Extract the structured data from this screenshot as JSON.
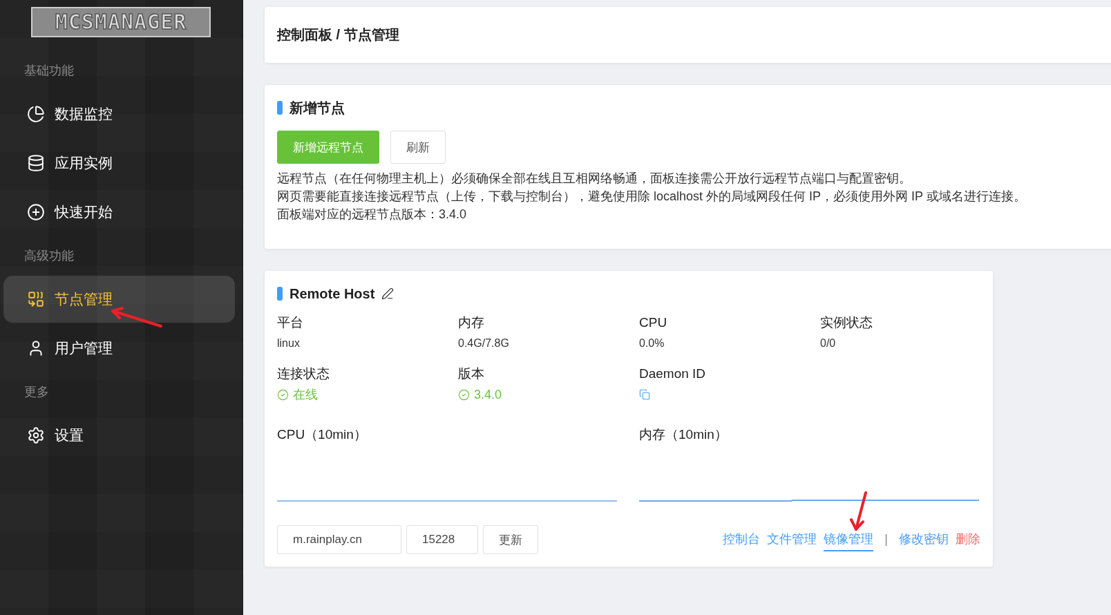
{
  "sidebar": {
    "logo": "MCSMANAGER",
    "groups": [
      {
        "title": "基础功能",
        "items": [
          {
            "label": "数据监控",
            "kind": "pie",
            "selected": false
          },
          {
            "label": "应用实例",
            "kind": "database",
            "selected": false
          },
          {
            "label": "快速开始",
            "kind": "plus",
            "selected": false
          }
        ]
      },
      {
        "title": "高级功能",
        "items": [
          {
            "label": "节点管理",
            "kind": "nodes",
            "selected": true
          },
          {
            "label": "用户管理",
            "kind": "user",
            "selected": false
          }
        ]
      },
      {
        "title": "更多",
        "items": [
          {
            "label": "设置",
            "kind": "gear",
            "selected": false
          }
        ]
      }
    ]
  },
  "breadcrumb": "控制面板 / 节点管理",
  "add_node_card": {
    "title": "新增节点",
    "buttons": [
      {
        "label": "新增远程节点",
        "kind": "primary"
      },
      {
        "label": "刷新",
        "kind": "default"
      }
    ],
    "notes": [
      "远程节点（在任何物理主机上）必须确保全部在线且互相网络畅通，面板连接需公开放行远程节点端口与配置密钥。",
      "网页需要能直接连接远程节点（上传，下载与控制台），避免使用除 localhost 外的局域网段任何 IP，必须使用外网 IP 或域名进行连接。",
      "面板端对应的远程节点版本：3.4.0"
    ]
  },
  "node_card": {
    "title": "Remote Host",
    "stats": [
      {
        "label": "平台",
        "value": "linux",
        "kind": "plain"
      },
      {
        "label": "内存",
        "value": "0.4G/7.8G",
        "kind": "plain"
      },
      {
        "label": "CPU",
        "value": "0.0%",
        "kind": "plain"
      },
      {
        "label": "实例状态",
        "value": "0/0",
        "kind": "plain"
      },
      {
        "label": "连接状态",
        "value": "在线",
        "kind": "ok"
      },
      {
        "label": "版本",
        "value": "3.4.0",
        "kind": "ok"
      },
      {
        "label": "Daemon ID",
        "kind": "copy"
      }
    ],
    "charts": [
      {
        "title": "CPU（10min）",
        "kind": "flat"
      },
      {
        "title": "内存（10min）",
        "kind": "step"
      }
    ],
    "address": "m.rainplay.cn",
    "port": "15228",
    "update_button": "更新",
    "actions": [
      {
        "label": "控制台",
        "kind": "link",
        "selected": false
      },
      {
        "label": "文件管理",
        "kind": "link",
        "selected": false
      },
      {
        "label": "镜像管理",
        "kind": "link",
        "selected": true
      },
      {
        "label": "|",
        "kind": "separator",
        "selected": false
      },
      {
        "label": "修改密钥",
        "kind": "link",
        "selected": false
      },
      {
        "label": "删除",
        "kind": "danger",
        "selected": false
      }
    ]
  }
}
